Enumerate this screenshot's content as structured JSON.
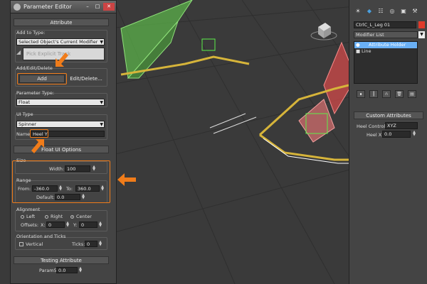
{
  "dialog": {
    "title": "Parameter Editor",
    "sections": {
      "attribute": "Attribute",
      "float_ui_options": "Float UI Options",
      "testing_attribute": "Testing Attribute"
    },
    "add_to_type": {
      "label": "Add to Type:",
      "value": "Selected Object's Current Modifier",
      "pick_button": "Pick Explicit Track"
    },
    "add_edit_delete": {
      "label": "Add/Edit/Delete",
      "add_button": "Add",
      "edit_delete_button": "Edit/Delete..."
    },
    "parameter_type": {
      "label": "Parameter Type:",
      "value": "Float"
    },
    "ui_type": {
      "label": "UI Type",
      "value": "Spinner",
      "name_label": "Name:",
      "name_value": "Heel Y"
    },
    "size": {
      "label": "Size",
      "width_label": "Width:",
      "width_value": "100"
    },
    "range": {
      "label": "Range",
      "from_label": "From:",
      "from_value": "-360.0",
      "to_label": "To:",
      "to_value": "360.0",
      "default_label": "Default:",
      "default_value": "0.0"
    },
    "alignment": {
      "label": "Alignment",
      "options": [
        "Left",
        "Right",
        "Center"
      ],
      "selected": "Center",
      "offsets_label": "Offsets:",
      "x_label": "X:",
      "x_value": "0",
      "y_label": "Y:",
      "y_value": "0"
    },
    "orientation": {
      "label": "Orientation and Ticks",
      "vertical_label": "Vertical",
      "ticks_label": "Ticks:",
      "ticks_value": "0"
    },
    "testing": {
      "param_label": "Param5:",
      "param_value": "0.0"
    }
  },
  "command_panel": {
    "object_name": "CtrlC_L_Leg 01",
    "modifier_list": "Modifier List",
    "stack": [
      "Attribute Holder",
      "Line"
    ],
    "custom_attributes": {
      "title": "Custom Attributes",
      "heel_control_label": "Heel Control:",
      "heel_control_value": "XYZ",
      "heel_x_label": "Heel X:",
      "heel_x_value": "0.0"
    }
  },
  "colors": {
    "annotation": "#f07c1a",
    "selection": "#6ab0f5"
  }
}
